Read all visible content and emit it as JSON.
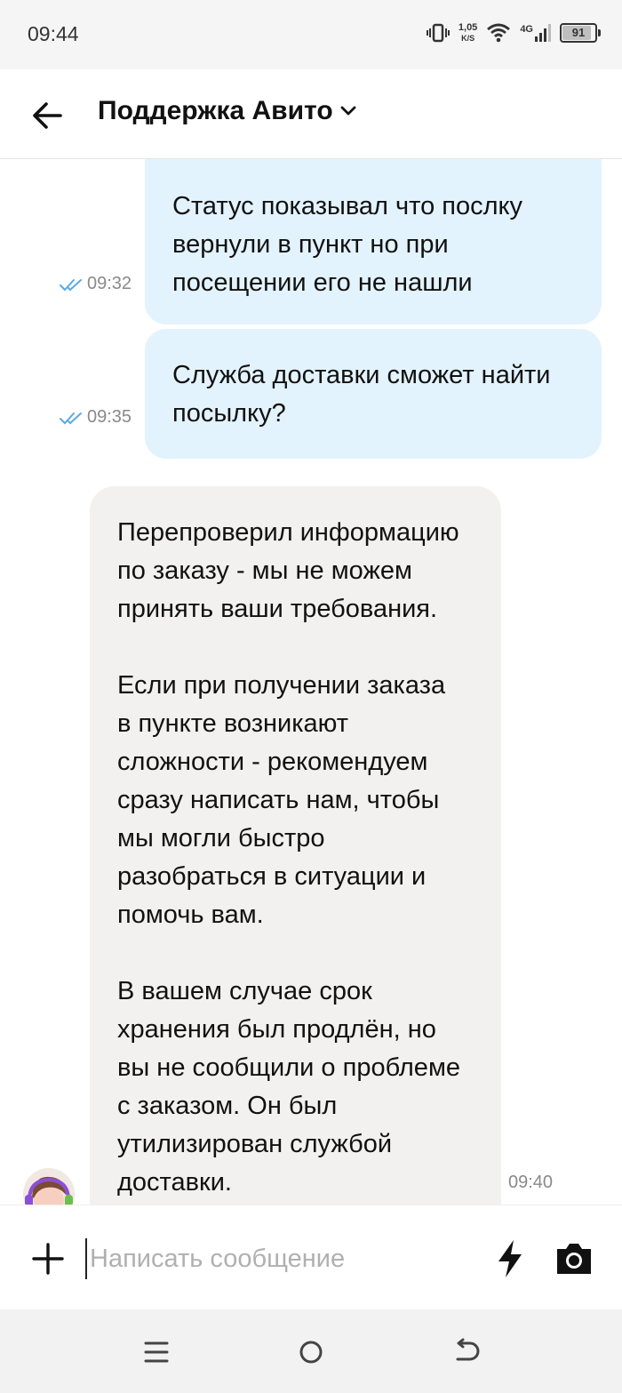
{
  "status_bar": {
    "time": "09:44",
    "speed_value": "1,05",
    "speed_unit": "K/S",
    "network": "4G",
    "battery": "91"
  },
  "header": {
    "title": "Поддержка Авито",
    "icons": [
      "back-arrow-icon",
      "chevron-down-icon"
    ]
  },
  "messages": [
    {
      "direction": "outgoing",
      "time": "09:32",
      "status": "read",
      "lines": [
        "Статус показывал что послку",
        "вернули в пункт но при",
        "посещении его не нашли"
      ]
    },
    {
      "direction": "outgoing",
      "time": "09:35",
      "status": "read",
      "lines": [
        "Служба доставки сможет найти",
        "посылку?"
      ]
    },
    {
      "direction": "incoming",
      "time": "09:40",
      "lines": [
        "Перепроверил информацию",
        "по заказу - мы не можем",
        "принять ваши требования.",
        "",
        "Если при получении заказа",
        "в пункте возникают",
        "сложности - рекомендуем",
        "сразу написать нам, чтобы",
        "мы могли быстро",
        "разобраться в ситуации и",
        "помочь вам.",
        "",
        "В вашем случае срок",
        "хранения был продлён, но",
        "вы не сообщили о проблеме",
        "с заказом. Он был",
        "утилизирован службой",
        "доставки."
      ]
    }
  ],
  "composer": {
    "placeholder": "Написать сообщение",
    "value": ""
  },
  "colors": {
    "outgoing_bubble": "#e3f3fd",
    "incoming_bubble": "#f2f1f0",
    "read_check": "#5aa9e6"
  }
}
